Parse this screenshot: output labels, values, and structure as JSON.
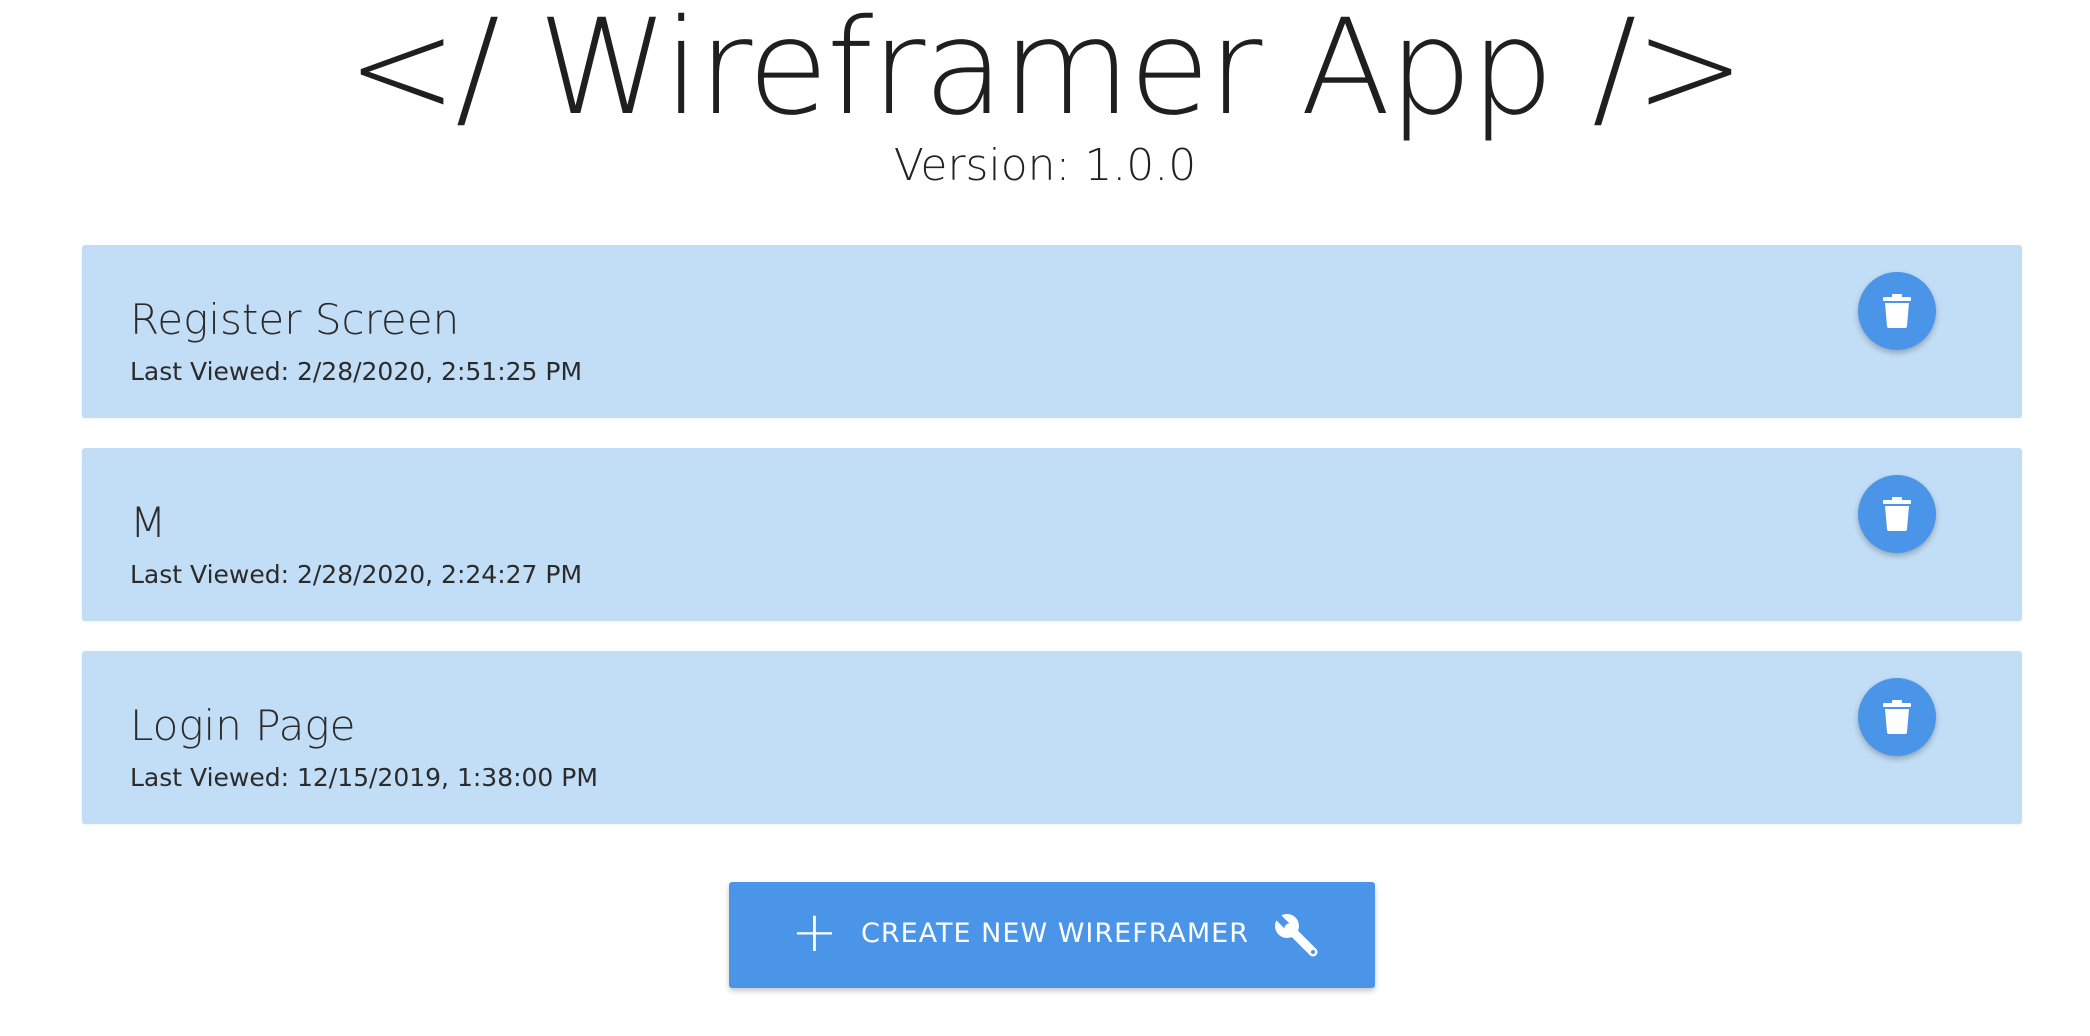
{
  "header": {
    "title": "</ Wireframer App />",
    "version": "Version: 1.0.0"
  },
  "wireframers": [
    {
      "name": "Register Screen",
      "last_viewed": "Last Viewed: 2/28/2020, 2:51:25 PM",
      "delete_icon": "trash-icon"
    },
    {
      "name": "M",
      "last_viewed": "Last Viewed: 2/28/2020, 2:24:27 PM",
      "delete_icon": "trash-icon"
    },
    {
      "name": "Login Page",
      "last_viewed": "Last Viewed: 12/15/2019, 1:38:00 PM",
      "delete_icon": "trash-icon"
    }
  ],
  "create_button": {
    "plus_icon": "plus-icon",
    "label": "CREATE NEW WIREFRAMER",
    "wrench_icon": "wrench-icon"
  },
  "colors": {
    "accent": "#4a95e8",
    "card_background": "#c2ddf6",
    "text": "#222222"
  }
}
